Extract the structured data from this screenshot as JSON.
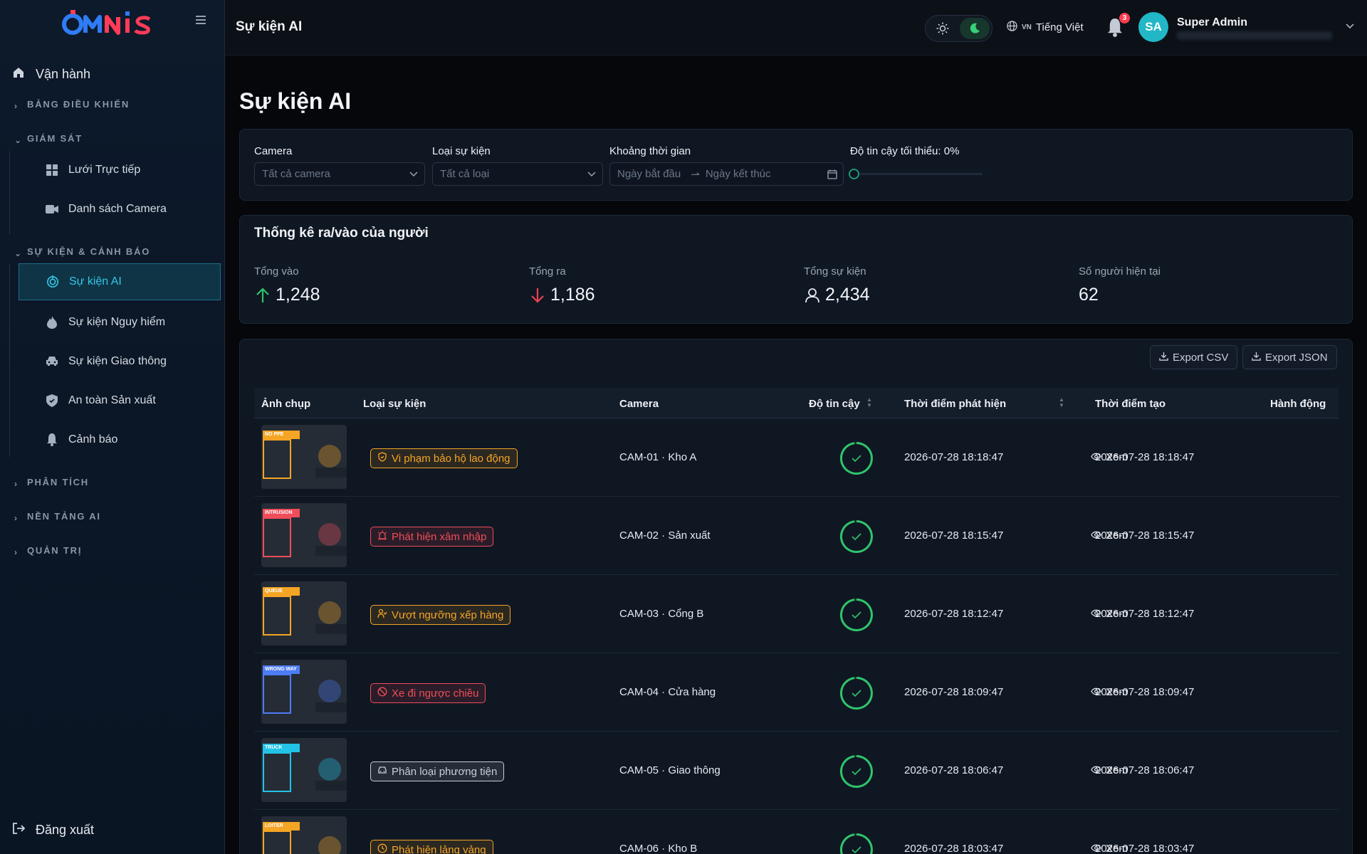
{
  "brand": {
    "logo": "OMNIS"
  },
  "sidebar": {
    "top": {
      "label": "Vận hành",
      "icon": "home-icon"
    },
    "sections": {
      "dashboard": "BẢNG ĐIỀU KHIỂN",
      "monitor": "GIÁM SÁT",
      "events": "SỰ KIỆN & CẢNH BÁO",
      "analytics": "PHÂN TÍCH",
      "platform": "NỀN TẢNG AI",
      "admin": "QUẢN TRỊ"
    },
    "monitor_items": [
      {
        "label": "Lưới Trực tiếp",
        "icon": "grid-icon"
      },
      {
        "label": "Danh sách Camera",
        "icon": "video-camera-icon"
      }
    ],
    "event_items": [
      {
        "label": "Sự kiện AI",
        "icon": "target-icon",
        "active": true
      },
      {
        "label": "Sự kiện Nguy hiểm",
        "icon": "fire-icon"
      },
      {
        "label": "Sự kiện Giao thông",
        "icon": "car-icon"
      },
      {
        "label": "An toàn Sản xuất",
        "icon": "shield-icon"
      },
      {
        "label": "Cảnh báo",
        "icon": "bell-icon"
      }
    ],
    "logout": "Đăng xuất"
  },
  "header": {
    "title": "Sự kiện AI",
    "lang_code": "VN",
    "lang_label": "Tiếng Việt",
    "notif_count": "3",
    "avatar": "SA",
    "user_name": "Super Admin"
  },
  "page": {
    "title": "Sự kiện AI"
  },
  "filters": {
    "camera": {
      "label": "Camera",
      "value": "Tất cả camera"
    },
    "event_type": {
      "label": "Loại sự kiện",
      "value": "Tất cả loại"
    },
    "range": {
      "label": "Khoảng thời gian",
      "start": "Ngày bắt đầu",
      "end": "Ngày kết thúc"
    },
    "confidence": {
      "label": "Độ tin cậy tối thiểu: 0%",
      "value": 0
    }
  },
  "stats": {
    "title": "Thống kê ra/vào của người",
    "items": [
      {
        "label": "Tổng vào",
        "value": "1,248"
      },
      {
        "label": "Tổng ra",
        "value": "1,186"
      },
      {
        "label": "Tổng sự kiện",
        "value": "2,434"
      },
      {
        "label": "Số người hiện tại",
        "value": "62"
      }
    ]
  },
  "table": {
    "export_csv": "Export CSV",
    "export_json": "Export JSON",
    "columns": [
      "Ảnh chụp",
      "Loại sự kiện",
      "Camera",
      "Độ tin cậy",
      "Thời điểm phát hiện",
      "Thời điểm tạo",
      "Hành động"
    ],
    "view_label": "Xem",
    "rows": [
      {
        "tag": "NO PPE",
        "tag_color": "#f5a524",
        "event": "Vi phạm bảo hộ lao động",
        "event_color": "#f5a524",
        "event_icon": "shield-check-icon",
        "camera": "CAM-01 · Kho A",
        "detected": "2026-07-28 18:18:47",
        "created": "2026-07-28 18:18:47"
      },
      {
        "tag": "INTRUSION",
        "tag_color": "#ef4d5a",
        "event": "Phát hiện xâm nhập",
        "event_color": "#ef4d5a",
        "event_icon": "siren-icon",
        "camera": "CAM-02 · Sản xuất",
        "detected": "2026-07-28 18:15:47",
        "created": "2026-07-28 18:15:47"
      },
      {
        "tag": "QUEUE",
        "tag_color": "#f5a524",
        "event": "Vượt ngưỡng xếp hàng",
        "event_color": "#f5a524",
        "event_icon": "users-icon",
        "camera": "CAM-03 · Cổng B",
        "detected": "2026-07-28 18:12:47",
        "created": "2026-07-28 18:12:47"
      },
      {
        "tag": "WRONG WAY",
        "tag_color": "#4d7cf5",
        "event": "Xe đi ngược chiều",
        "event_color": "#ef4d5a",
        "event_icon": "ban-icon",
        "camera": "CAM-04 · Cửa hàng",
        "detected": "2026-07-28 18:09:47",
        "created": "2026-07-28 18:09:47"
      },
      {
        "tag": "TRUCK",
        "tag_color": "#22c3e6",
        "event": "Phân loại phương tiện",
        "event_color": "#c8cfda",
        "event_icon": "car-icon",
        "camera": "CAM-05 · Giao thông",
        "detected": "2026-07-28 18:06:47",
        "created": "2026-07-28 18:06:47"
      },
      {
        "tag": "LOITER",
        "tag_color": "#f5a524",
        "event": "Phát hiện lảng vảng",
        "event_color": "#f5a524",
        "event_icon": "clock-icon",
        "camera": "CAM-06 · Kho B",
        "detected": "2026-07-28 18:03:47",
        "created": "2026-07-28 18:03:47"
      }
    ]
  }
}
